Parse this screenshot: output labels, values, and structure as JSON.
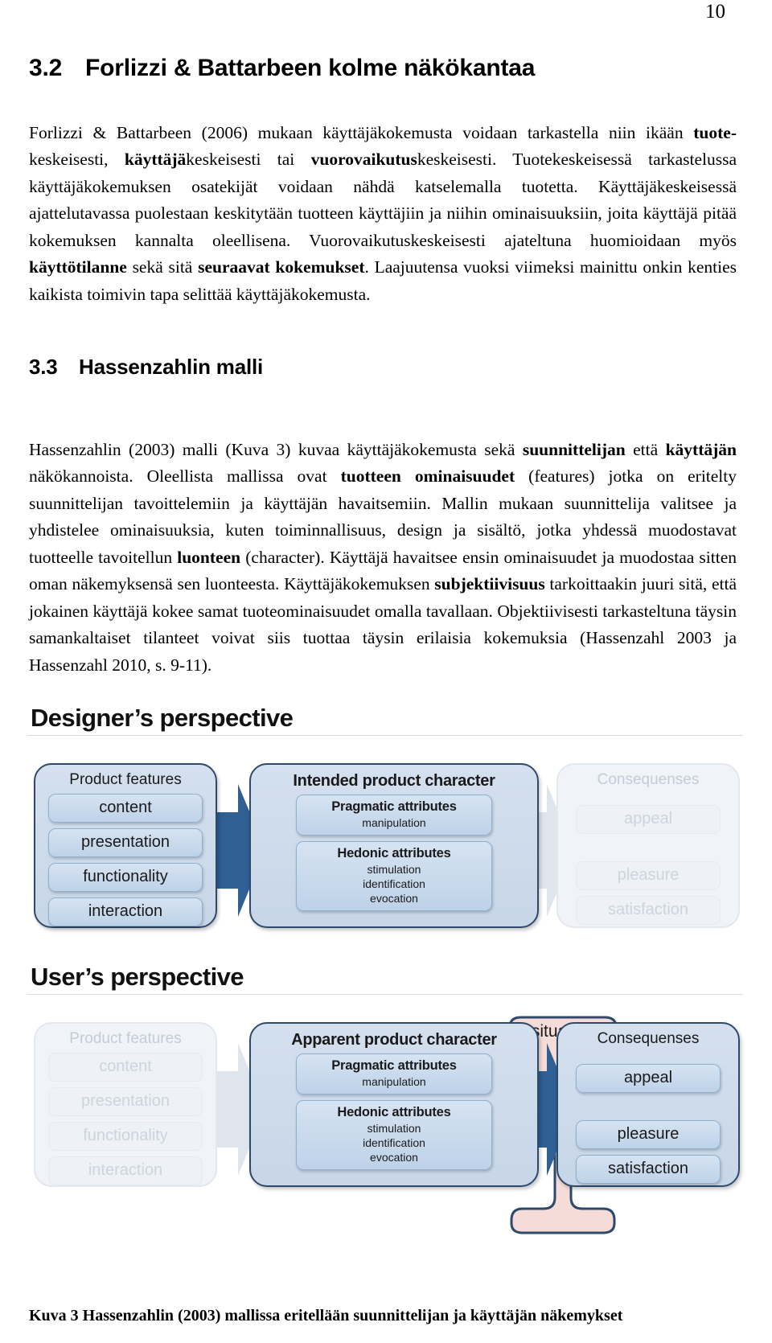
{
  "page": {
    "number": "10"
  },
  "sections": [
    {
      "number": "3.2",
      "title": "Forlizzi & Battarbeen kolme näkökantaa"
    },
    {
      "number": "3.3",
      "title": "Hassenzahlin malli"
    }
  ],
  "paragraphs": {
    "p1": {
      "seg1": "Forlizzi & Battarbeen (2006) mukaan käyttäjäkokemusta voidaan tarkastella niin ikään ",
      "b1": "tuote-",
      "seg2": "keskeisesti, ",
      "b2": "käyttäjä",
      "seg3": "keskeisesti tai ",
      "b3": "vuorovaikutus",
      "seg4": "keskeisesti. Tuotekeskeisessä tarkastelussa käyttäjäkokemuksen osatekijät voidaan nähdä katselemalla tuotetta. Käyttäjäkeskeisessä ajattelutavassa puolestaan keskitytään tuotteen käyttäjiin ja niihin ominaisuuksiin, joita käyttäjä pitää kokemuksen kannalta oleellisena. Vuorovaikutuskeskeisesti ajateltuna huomioidaan myös ",
      "b4": "käyttötilanne",
      "seg5": " sekä sitä ",
      "b5": "seuraavat kokemukset",
      "seg6": ". Laajuutensa vuoksi viimeksi mainittu onkin kenties kaikista toimivin tapa selittää käyttäjäkokemusta."
    },
    "p2": {
      "seg1": "Hassenzahlin (2003) malli (Kuva 3) kuvaa käyttäjäkokemusta sekä ",
      "b1": "suunnittelijan",
      "seg2": " että ",
      "b2": "käyttäjän",
      "seg3": " näkökannoista. Oleellista mallissa ovat ",
      "b3": "tuotteen ominaisuudet",
      "seg4": " (features) jotka on eritelty suunnittelijan tavoittelemiin ja käyttäjän havaitsemiin. Mallin mukaan suunnittelija valitsee ja yhdistelee ominaisuuksia, kuten toiminnallisuus, design ja sisältö, jotka yhdessä muodostavat tuotteelle tavoitellun ",
      "b4": "luonteen",
      "seg5": " (character). Käyttäjä havaitsee ensin ominaisuudet ja muodostaa sitten oman näkemyksensä sen luonteesta. Käyttäjäkokemuksen ",
      "b5": "subjektiivisuus",
      "seg6": " tarkoittaakin juuri sitä, että jokainen käyttäjä kokee samat tuoteominaisuudet omalla tavallaan. Objektiivisesti tarkasteltuna täysin samankaltaiset tilanteet voivat siis tuottaa täysin erilaisia kokemuksia (Hassenzahl 2003 ja Hassenzahl 2010, s. 9-11)."
    }
  },
  "figure": {
    "caption": "Kuva 3 Hassenzahlin (2003) mallissa eritellään suunnittelijan ja käyttäjän näkemykset",
    "colors": {
      "card_border": "#2e4a6b",
      "card_fill": "#cfdcec",
      "pill_fill": "#c9daee",
      "arrow": "#2f5f93",
      "faded": "#eef1f6",
      "situation_fill": "#f6dcd8"
    },
    "panels": [
      {
        "id": "designer",
        "title": "Designer’s perspective",
        "features_card": {
          "title": "Product features",
          "faded": false,
          "items": [
            "content",
            "presentation",
            "functionality",
            "interaction"
          ]
        },
        "character_card": {
          "title": "Intended product character",
          "faded": false,
          "attributes": [
            {
              "head": "Pragmatic attributes",
              "subs": [
                "manipulation"
              ]
            },
            {
              "head": "Hedonic attributes",
              "subs": [
                "stimulation",
                "identification",
                "evocation"
              ]
            }
          ]
        },
        "consequences_card": {
          "title": "Consequenses",
          "faded": true,
          "items": [
            "appeal",
            "pleasure",
            "satisfaction"
          ]
        },
        "situation": {
          "visible": false,
          "label": "situation"
        }
      },
      {
        "id": "user",
        "title": "User’s perspective",
        "features_card": {
          "title": "Product features",
          "faded": true,
          "items": [
            "content",
            "presentation",
            "functionality",
            "interaction"
          ]
        },
        "character_card": {
          "title": "Apparent product character",
          "faded": false,
          "attributes": [
            {
              "head": "Pragmatic attributes",
              "subs": [
                "manipulation"
              ]
            },
            {
              "head": "Hedonic attributes",
              "subs": [
                "stimulation",
                "identification",
                "evocation"
              ]
            }
          ]
        },
        "consequences_card": {
          "title": "Consequenses",
          "faded": false,
          "items": [
            "appeal",
            "pleasure",
            "satisfaction"
          ]
        },
        "situation": {
          "visible": true,
          "label": "situation"
        }
      }
    ]
  }
}
